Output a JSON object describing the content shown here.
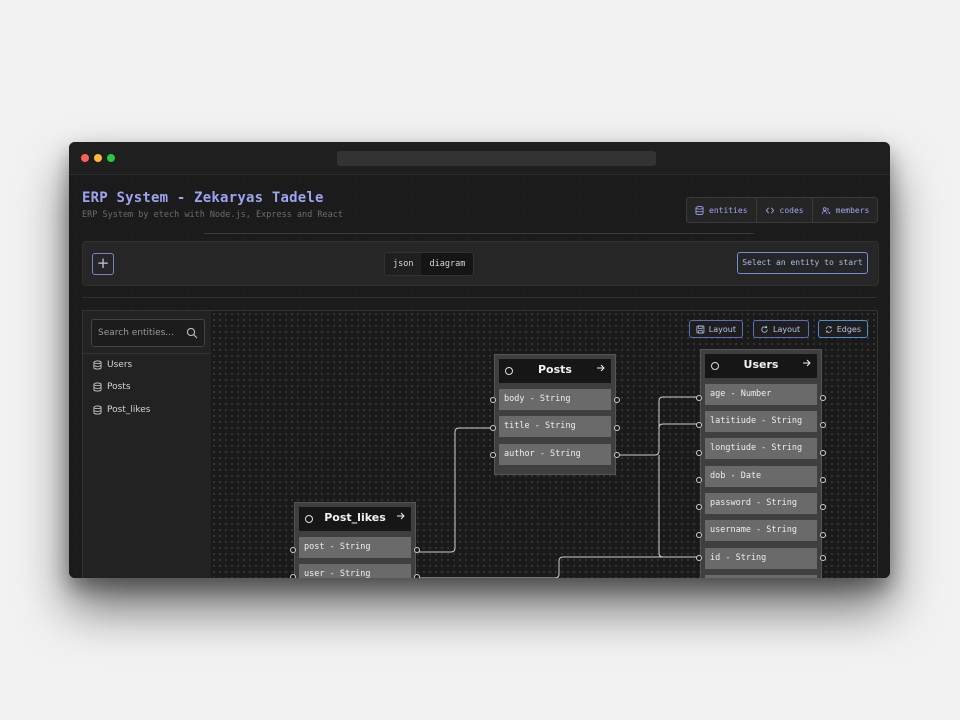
{
  "app": {
    "title": "ERP System - Zekaryas Tadele",
    "subtitle": "ERP System by etech with Node.js, Express and React"
  },
  "top_tabs": [
    {
      "label": "entities",
      "icon": "database-icon"
    },
    {
      "label": "codes",
      "icon": "code-icon"
    },
    {
      "label": "members",
      "icon": "members-icon"
    }
  ],
  "toolbar": {
    "add_label": "+",
    "view_modes": [
      "json",
      "diagram"
    ],
    "selected_view": "diagram",
    "select_entity_label": "Select an entity to start"
  },
  "sidebar": {
    "search_placeholder": "Search entities...",
    "entities": [
      "Users",
      "Posts",
      "Post_likes"
    ]
  },
  "canvas": {
    "buttons": [
      {
        "label": "Layout",
        "icon": "save-icon"
      },
      {
        "label": "Layout",
        "icon": "refresh-icon"
      },
      {
        "label": "Edges",
        "icon": "sync-icon"
      }
    ]
  },
  "nodes": {
    "posts": {
      "title": "Posts",
      "fields": [
        "body - String",
        "title - String",
        "author - String"
      ]
    },
    "users": {
      "title": "Users",
      "fields": [
        "age - Number",
        "latitiude - String",
        "longtiude - String",
        "dob - Date",
        "password - String",
        "username - String",
        "id - String"
      ]
    },
    "post_likes": {
      "title": "Post_likes",
      "fields": [
        "post - String",
        "user - String"
      ]
    }
  },
  "colors": {
    "accent": "#9ea3f0",
    "node_bg": "#3f3f3f",
    "field_bg": "#6a6a6a",
    "edge": "#cfcfcf"
  }
}
